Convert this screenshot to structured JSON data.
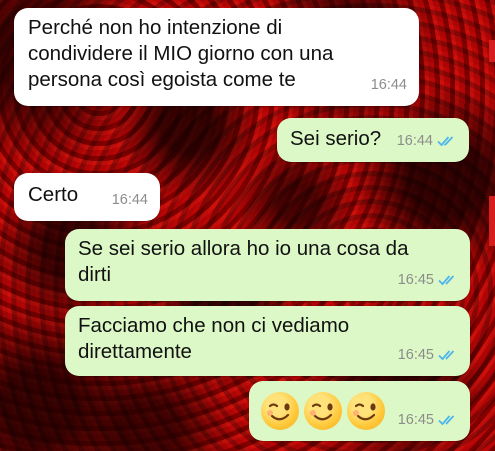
{
  "messages": [
    {
      "dir": "in",
      "text": "Perché non ho intenzione di\ncondividere il MIO giorno con una\npersona così egoista come te",
      "time": "16:44"
    },
    {
      "dir": "out",
      "text": "Sei serio?",
      "time": "16:44",
      "read": true
    },
    {
      "dir": "in",
      "text": "Certo",
      "time": "16:44"
    },
    {
      "dir": "out",
      "text": "Se sei serio allora ho io una cosa da\ndirti",
      "time": "16:45",
      "read": true
    },
    {
      "dir": "out",
      "text": "Facciamo che non ci vediamo\ndirettamente",
      "time": "16:45",
      "read": true
    },
    {
      "dir": "out",
      "emoji": [
        "winking-face-emoji",
        "winking-face-emoji",
        "winking-face-emoji"
      ],
      "time": "16:45",
      "read": true
    }
  ],
  "colors": {
    "incoming_bubble": "#ffffff",
    "outgoing_bubble": "#dcf8c6",
    "read_ticks": "#4fb6ec",
    "timestamp": "#8c8c8c"
  },
  "icons": {
    "read_receipt": "double-check-icon",
    "background": "red-roses-wallpaper"
  }
}
